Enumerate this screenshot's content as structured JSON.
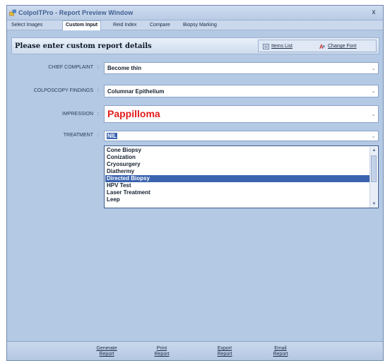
{
  "window": {
    "title": "ColpoITPro - Report Preview Window",
    "close_glyph": "x"
  },
  "tabs": [
    {
      "label": "Select Images",
      "active": false
    },
    {
      "label": "Custom Input",
      "active": true
    },
    {
      "label": "Reid Index",
      "active": false
    },
    {
      "label": "Compare",
      "active": false
    },
    {
      "label": "Biopsy Marking",
      "active": false
    }
  ],
  "header": {
    "title": "Please enter custom report details",
    "items_list_label": "Items List",
    "change_font_label": "Change Font"
  },
  "fields": {
    "chief_complaint": {
      "label": "CHIEF COMPLAINT",
      "value": "Become thin"
    },
    "colposcopy_findings": {
      "label": "COLPOSCOPY FINDINGS",
      "value": "Columnar Epithelium"
    },
    "impression": {
      "label": "IMPRESSION",
      "value": "Pappilloma"
    },
    "treatment": {
      "label": "TREATMENT",
      "value": "NIL"
    }
  },
  "separator": ":",
  "treatment_options": [
    "Cone Biopsy",
    "Conization",
    "Cryosurgery",
    "Diathermy",
    "Directed Biopsy",
    "HPV Test",
    "Laser Treatment",
    "Leep"
  ],
  "treatment_highlighted": "Directed Biopsy",
  "footer": {
    "generate": [
      "Generate",
      "Report"
    ],
    "print": [
      "Print",
      "Report"
    ],
    "export": [
      "Export",
      "Report"
    ],
    "email": [
      "Email",
      "Report"
    ]
  },
  "colors": {
    "panel": "#b3c9e4",
    "title_text": "#3d5f91",
    "impression_text": "#e31b1b",
    "selection": "#3a64b0"
  },
  "icons": {
    "app": "colposcope-app-icon",
    "close": "close-icon",
    "items_list": "list-icon",
    "change_font": "font-icon",
    "combo_arrow": "chevron-down-icon"
  }
}
